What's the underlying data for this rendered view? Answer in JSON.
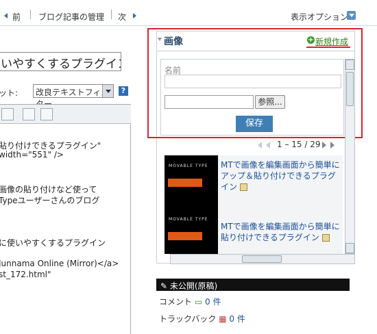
{
  "nav": {
    "prev_label": "前",
    "manage_label": "ブログ記事の管理",
    "next_label": "次",
    "display_options_label": "表示オプション"
  },
  "editor": {
    "title_value": "いやすくするプラグイン",
    "filter_label": "ット:",
    "filter_value": "改良テキストフィルター",
    "help_label": "?",
    "lines": [
      "貼り付けできるプラグイン\"",
      "width=\"551\" />",
      "画像の貼り付けなど使って",
      "Typeユーザーさんのブログ",
      "に使いやすくするプラグイン",
      "Junnama Online (Mirror)</a>",
      "st_172.html\""
    ]
  },
  "panel": {
    "title": "画像",
    "new_label": "新規作成",
    "new_icon": "plus-circle-icon",
    "name_label": "名前",
    "name_value": "",
    "file_value": "",
    "browse_label": "参照...",
    "save_label": "保存",
    "pager_text": "1 – 15 / 29",
    "items": [
      {
        "title": "MTで画像を編集画面から簡単にアップ＆貼り付けできるプラグイン",
        "brand": "MOVABLE TYPE"
      },
      {
        "title": "MTで画像を編集画面から簡単に貼り付けできるプラグイン",
        "brand": "MOVABLE TYPE"
      }
    ]
  },
  "status": {
    "label": "未公開(原稿)",
    "comment_label": "コメント",
    "comment_count": "0 件",
    "trackback_label": "トラックバック",
    "trackback_count": "0 件"
  },
  "colors": {
    "highlight_border": "#e0202a",
    "save_button": "#3f7fb6",
    "link": "#1a4e9a",
    "new_link": "#3a7d1e"
  }
}
